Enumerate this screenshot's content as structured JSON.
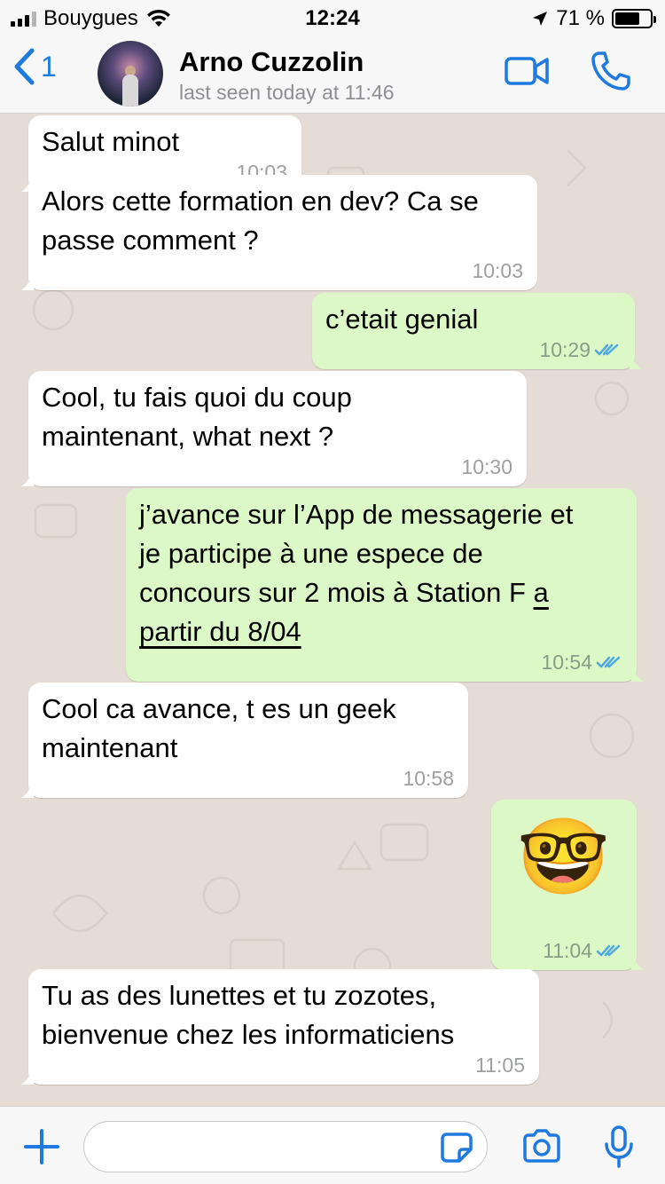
{
  "status_bar": {
    "carrier": "Bouygues",
    "time": "12:24",
    "battery": "71 %",
    "battery_level": 0.71
  },
  "header": {
    "back_count": "1",
    "contact_name": "Arno Cuzzolin",
    "contact_status": "last seen today at 11:46"
  },
  "colors": {
    "accent": "#1f7ae0",
    "outgoing_bubble": "#dcf8c6",
    "incoming_bubble": "#ffffff",
    "chat_background": "#e5ddd5",
    "read_ticks": "#4fa8e0"
  },
  "messages": [
    {
      "direction": "in",
      "lines": [
        "Salut minot"
      ],
      "time": "10:03"
    },
    {
      "direction": "in",
      "lines": [
        "Alors cette formation en dev? Ca se",
        "passe comment ?"
      ],
      "time": "10:03"
    },
    {
      "direction": "out",
      "lines": [
        "c’etait genial"
      ],
      "time": "10:29",
      "status": "read"
    },
    {
      "direction": "in",
      "lines": [
        "Cool, tu fais quoi du coup",
        "maintenant, what next ?"
      ],
      "time": "10:30"
    },
    {
      "direction": "out",
      "lines": [
        "j’avance sur l’App de messagerie et",
        "je participe à une espece de",
        "concours sur 2 mois à Station F",
        "a",
        "partir du 8/04"
      ],
      "time": "10:54",
      "status": "read"
    },
    {
      "direction": "in",
      "lines": [
        "Cool ca avance, t es un geek",
        "maintenant"
      ],
      "time": "10:58"
    },
    {
      "direction": "out",
      "emoji": "🤓",
      "emoji_name": "nerd-face-emoji",
      "time": "11:04",
      "status": "read"
    },
    {
      "direction": "in",
      "lines": [
        "Tu as des lunettes et tu zozotes,",
        "bienvenue chez les informaticiens"
      ],
      "time": "11:05"
    }
  ],
  "input": {
    "value": "",
    "placeholder": ""
  },
  "icons": [
    "signal-icon",
    "wifi-icon",
    "location-arrow-icon",
    "battery-icon",
    "back-chevron-icon",
    "video-call-icon",
    "phone-icon",
    "plus-icon",
    "sticker-icon",
    "camera-icon",
    "microphone-icon",
    "double-check-icon"
  ]
}
